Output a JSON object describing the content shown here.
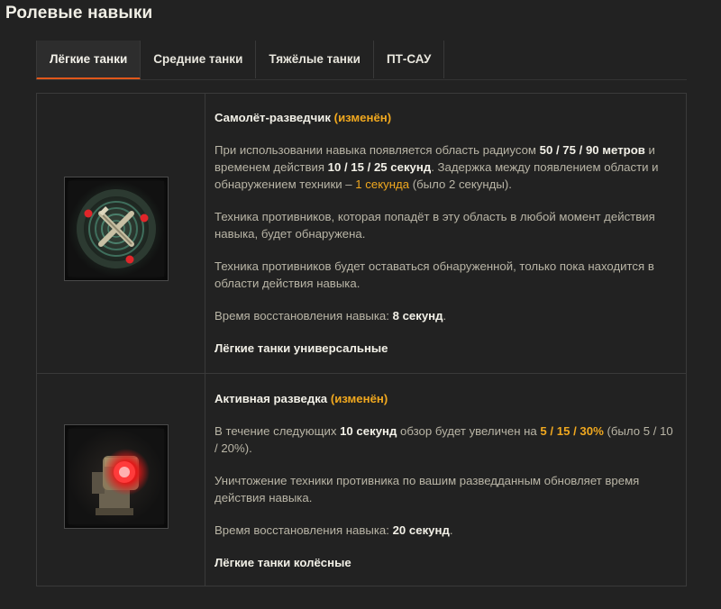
{
  "page": {
    "title": "Ролевые навыки"
  },
  "tabs": [
    {
      "label": "Лёгкие танки",
      "active": true
    },
    {
      "label": "Средние танки",
      "active": false
    },
    {
      "label": "Тяжёлые танки",
      "active": false
    },
    {
      "label": "ПТ-САУ",
      "active": false
    }
  ],
  "colors": {
    "accent": "#e0571b",
    "highlight": "#f0a81f",
    "background": "#222222"
  },
  "skills": [
    {
      "icon": "scout-plane-icon",
      "name": "Самолёт-разведчик",
      "status": "(изменён)",
      "p1": {
        "a": "При использовании навыка появляется область радиусом ",
        "b": "50 / 75 / 90 метров",
        "c": " и временем действия ",
        "d": "10 / 15 / 25 секунд",
        "e": ". Задержка между появлением области и обнаружением техники – ",
        "f": "1 секунда",
        "g": " (было 2 секунды)."
      },
      "p2": "Техника противников, которая попадёт в эту область в любой момент действия навыка, будет обнаружена.",
      "p3": "Техника противников будет оставаться обнаруженной, только пока находится в области действия навыка.",
      "p4": {
        "a": "Время восстановления навыка: ",
        "b": "8 секунд",
        "c": "."
      },
      "tank_class": "Лёгкие танки универсальные"
    },
    {
      "icon": "active-scouting-icon",
      "name": "Активная разведка",
      "status": "(изменён)",
      "p1": {
        "a": "В течение следующих ",
        "b": "10 секунд",
        "c": " обзор будет увеличен на ",
        "d": "5 / 15 / 30%",
        "e": " (было 5 / 10 / 20%)."
      },
      "p2": "Уничтожение техники противника по вашим разведданным обновляет время действия навыка.",
      "p3": {
        "a": "Время восстановления навыка: ",
        "b": "20 секунд",
        "c": "."
      },
      "tank_class": "Лёгкие танки колёсные"
    }
  ]
}
